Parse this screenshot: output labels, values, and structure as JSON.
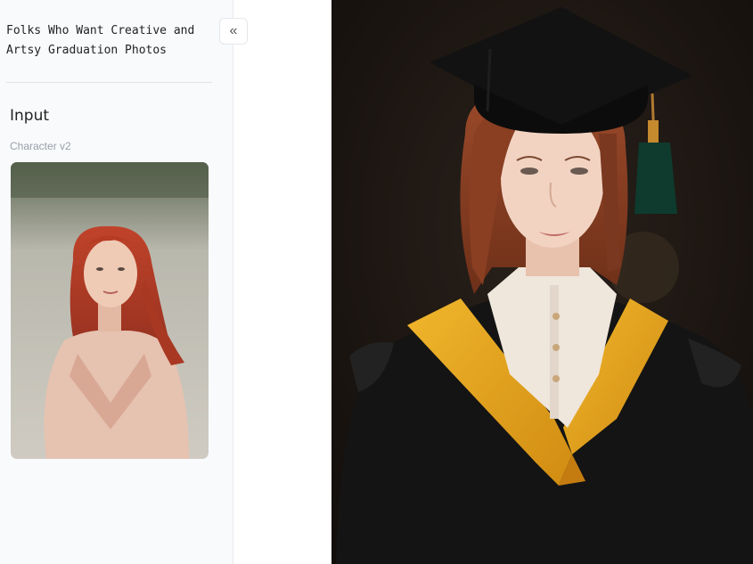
{
  "sidebar": {
    "title": "Folks Who Want Creative and Artsy Graduation Photos",
    "section_heading": "Input",
    "input_label": "Character v2",
    "collapse_icon": "chevron-double-left-icon"
  },
  "colors": {
    "sidebar_bg": "#f8fafc",
    "gown_stripe": "#e8a820",
    "gown": "#111111",
    "hair": "#b8452a"
  }
}
